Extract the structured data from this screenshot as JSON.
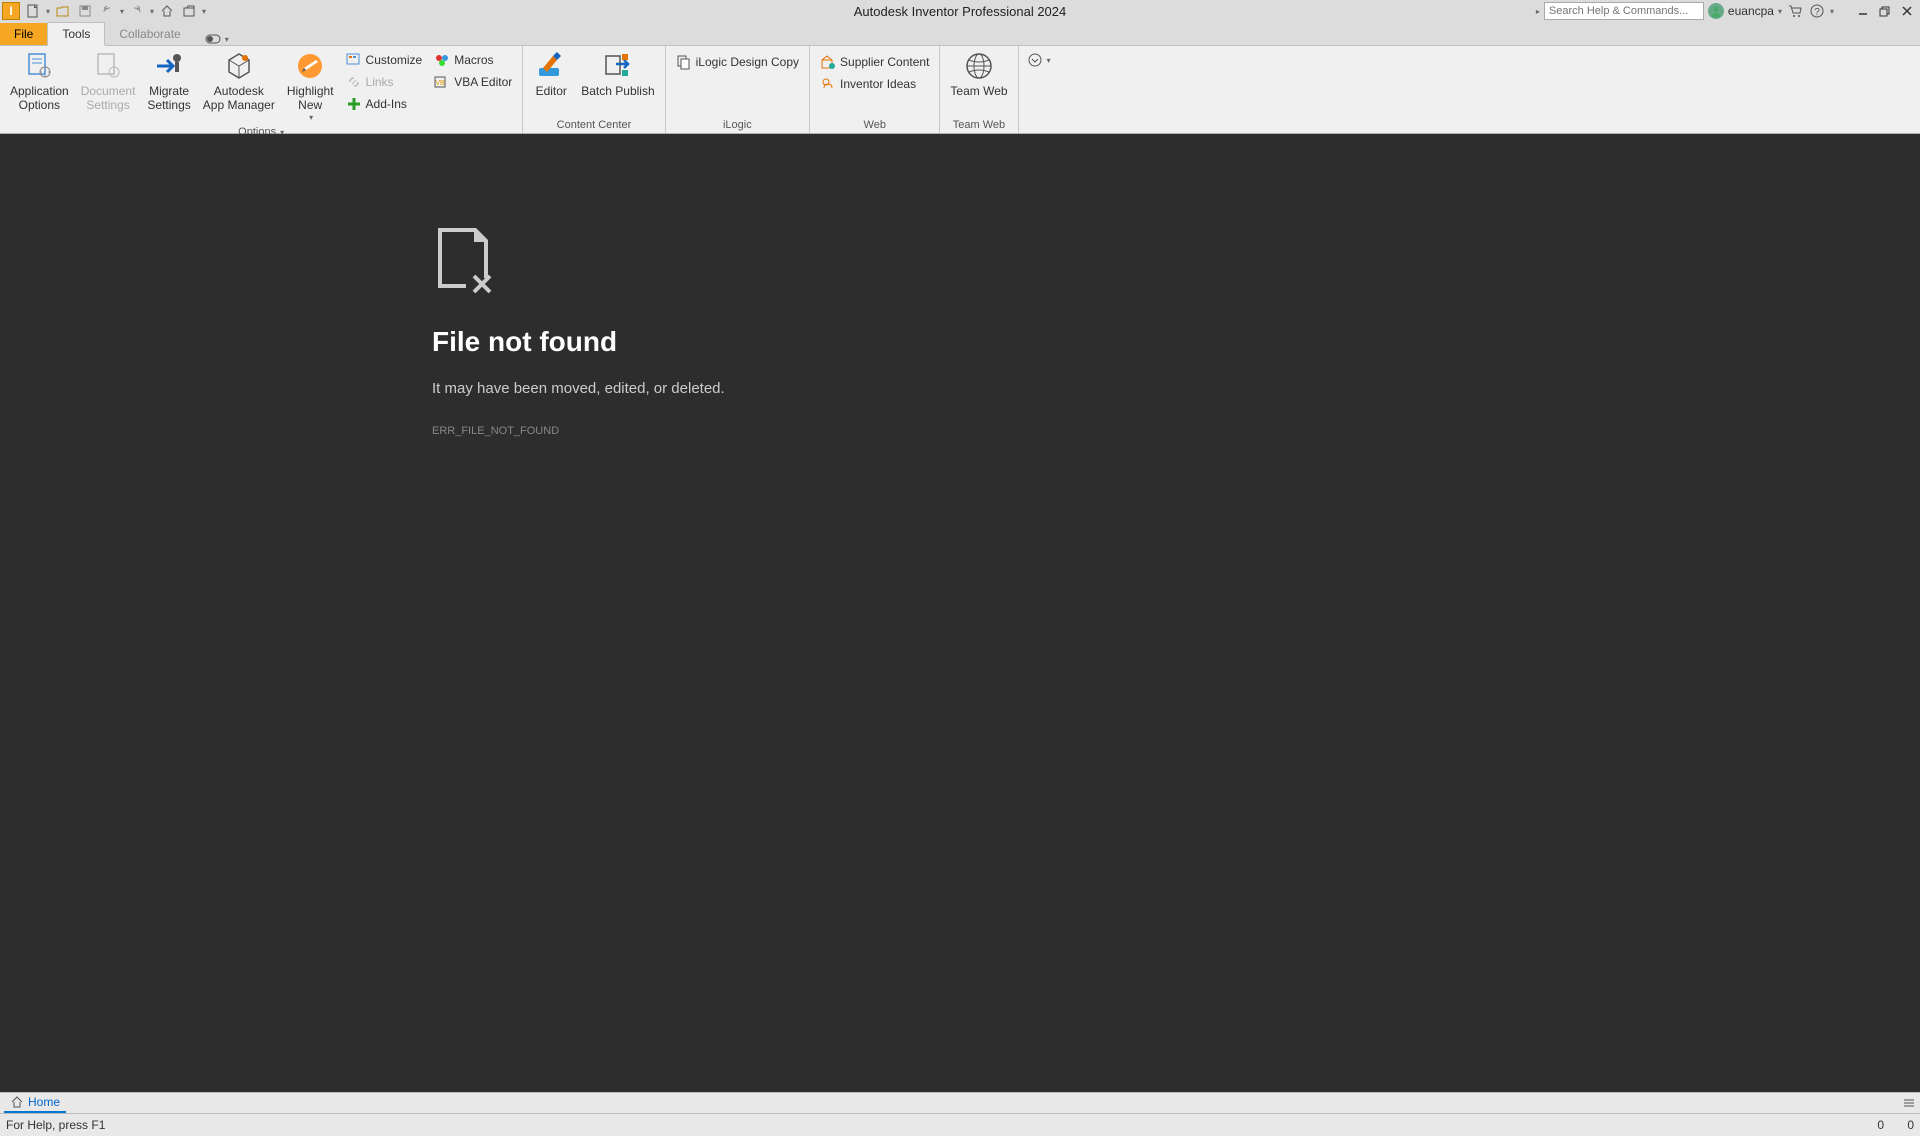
{
  "app": {
    "title": "Autodesk Inventor Professional 2024",
    "logo_letter": "I"
  },
  "qat": {
    "new": "⎘",
    "open": "📂",
    "save": "💾",
    "undo": "↶",
    "redo": "↷",
    "home": "⌂",
    "projects": "🗀"
  },
  "search": {
    "placeholder": "Search Help & Commands..."
  },
  "user": {
    "name": "euancpa"
  },
  "tabs": {
    "file": "File",
    "tools": "Tools",
    "collaborate": "Collaborate"
  },
  "ribbon": {
    "options_panel": {
      "app_options": "Application\nOptions",
      "doc_settings": "Document\nSettings",
      "migrate": "Migrate\nSettings",
      "app_manager": "Autodesk\nApp Manager",
      "highlight_new": "Highlight\nNew",
      "customize": "Customize",
      "links": "Links",
      "addins": "Add-Ins",
      "macros": "Macros",
      "vba": "VBA Editor",
      "label": "Options"
    },
    "content_center_panel": {
      "editor": "Editor",
      "batch": "Batch Publish",
      "label": "Content Center"
    },
    "ilogic_panel": {
      "design_copy": "iLogic Design Copy",
      "label": "iLogic"
    },
    "web_panel": {
      "supplier": "Supplier Content",
      "ideas": "Inventor Ideas",
      "label": "Web"
    },
    "teamweb_panel": {
      "teamweb": "Team Web",
      "label": "Team Web"
    }
  },
  "error": {
    "title": "File not found",
    "message": "It may have been moved, edited, or deleted.",
    "code": "ERR_FILE_NOT_FOUND"
  },
  "doc_tabs": {
    "home": "Home"
  },
  "status": {
    "help": "For Help, press F1",
    "num1": "0",
    "num2": "0"
  }
}
